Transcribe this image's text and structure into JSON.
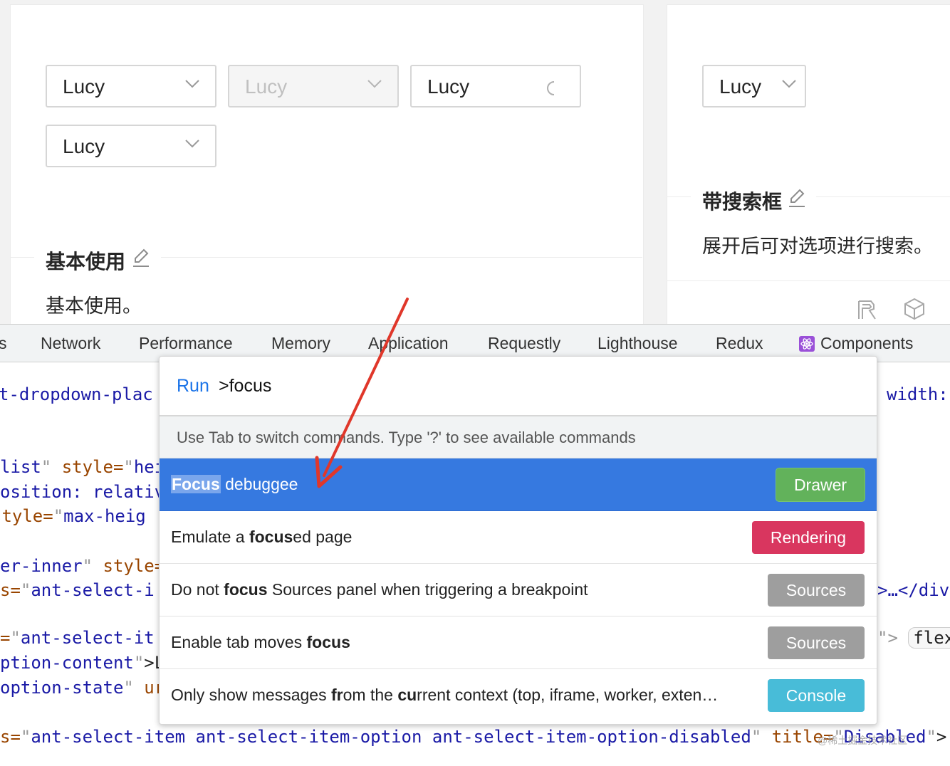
{
  "selects": {
    "s1": "Lucy",
    "s2": "Lucy",
    "s3": "Lucy",
    "s4": "Lucy",
    "s5": "Lucy"
  },
  "left_card": {
    "title": "基本使用",
    "description": "基本使用。"
  },
  "right_card": {
    "title": "带搜索框",
    "description": "展开后可对选项进行搜索。"
  },
  "devtools_tabs": [
    "s",
    "Network",
    "Performance",
    "Memory",
    "Application",
    "Requestly",
    "Lighthouse",
    "Redux",
    "Components"
  ],
  "code_lines": {
    "l1": "t-dropdown-plac",
    "l2a": "list",
    "l2b": " style=",
    "l2c": "hei",
    "l3": "osition: relativ",
    "l4a": " style=",
    "l4b": "max-heig",
    "l5a": "er-inner",
    "l5b": " style=",
    "l6a": "s=",
    "l6b": "ant-select-i",
    "l7a": "=",
    "l7b": "ant-select-it",
    "l8a": "ption-content",
    "l8b": ">L",
    "l9a": "option-state",
    "l9b": " ur",
    "l10a": "s=",
    "l10b": "ant-select-item ant-select-item-option ant-select-item-option-disabled",
    "l10c": " title=",
    "l10d": "Disabled",
    "l10e": ">.",
    "r1": "width:",
    "r2": ">…</div",
    "r3a": "\">",
    "r3b": "flex",
    "watermark": "@稀土掘金技术社区"
  },
  "palette": {
    "run_label": "Run",
    "query": ">focus",
    "hint": "Use Tab to switch commands. Type '?' to see available commands",
    "items": [
      {
        "pre": "",
        "bold": "Focus",
        "post": " debuggee",
        "badge": "Drawer",
        "color": "#62b25b"
      },
      {
        "pre": "Emulate a ",
        "bold": "focus",
        "post": "ed page",
        "badge": "Rendering",
        "color": "#d9365f"
      },
      {
        "pre": "Do not ",
        "bold": "focus",
        "post": " Sources panel when triggering a breakpoint",
        "badge": "Sources",
        "color": "#9e9e9e"
      },
      {
        "pre": "Enable tab moves ",
        "bold": "focus",
        "post": "",
        "badge": "Sources",
        "color": "#9e9e9e"
      },
      {
        "pre": "Only show messages ",
        "bold": "fr",
        "mid": "om the ",
        "bold2": "cu",
        "post": "rrent context (top, iframe, worker, exten…",
        "badge": "Console",
        "color": "#48bcd8"
      }
    ]
  },
  "colors": {
    "highlight_row": "#3679e0",
    "arrow": "#e0372a"
  }
}
